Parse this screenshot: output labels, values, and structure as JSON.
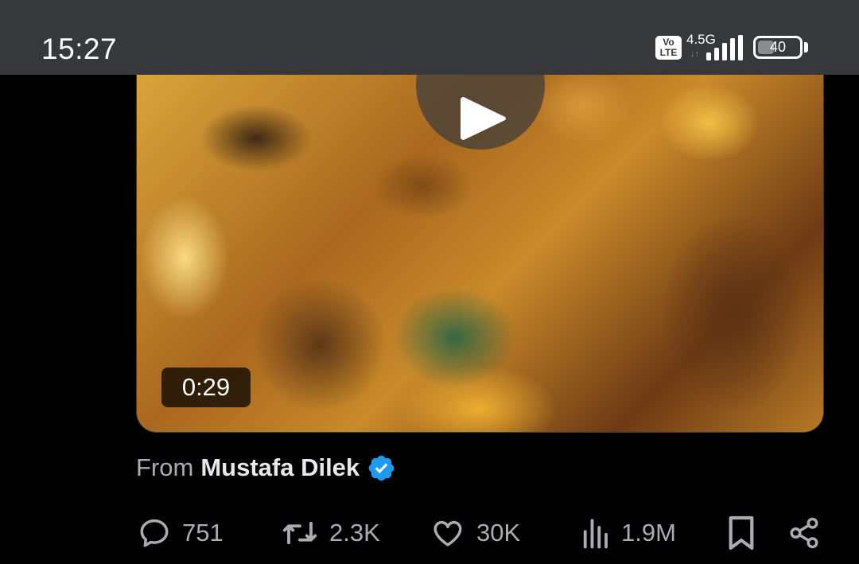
{
  "status_bar": {
    "time": "15:27",
    "volte_top": "Vo",
    "volte_bottom": "LTE",
    "network": "4.5G",
    "network_arrows": "↓↑",
    "signal_icon": "signal-bars-icon",
    "battery_level": "40",
    "battery_fraction": 0.4
  },
  "video": {
    "duration": "0:29",
    "play_icon": "play-icon"
  },
  "source": {
    "from_label": "From",
    "author": "Mustafa Dilek",
    "verified_icon": "verified-badge-icon",
    "verified_color": "#1d9bf0"
  },
  "actions": {
    "replies": {
      "icon": "reply-icon",
      "count": "751"
    },
    "reposts": {
      "icon": "repost-icon",
      "count": "2.3K"
    },
    "likes": {
      "icon": "heart-icon",
      "count": "30K"
    },
    "views": {
      "icon": "views-icon",
      "count": "1.9M"
    },
    "bookmark": {
      "icon": "bookmark-icon"
    },
    "share": {
      "icon": "share-icon"
    }
  },
  "colors": {
    "status_bar_bg": "#36383b",
    "background": "#000000",
    "muted_text": "#a9adb2",
    "primary_text": "#e7e9ea"
  }
}
